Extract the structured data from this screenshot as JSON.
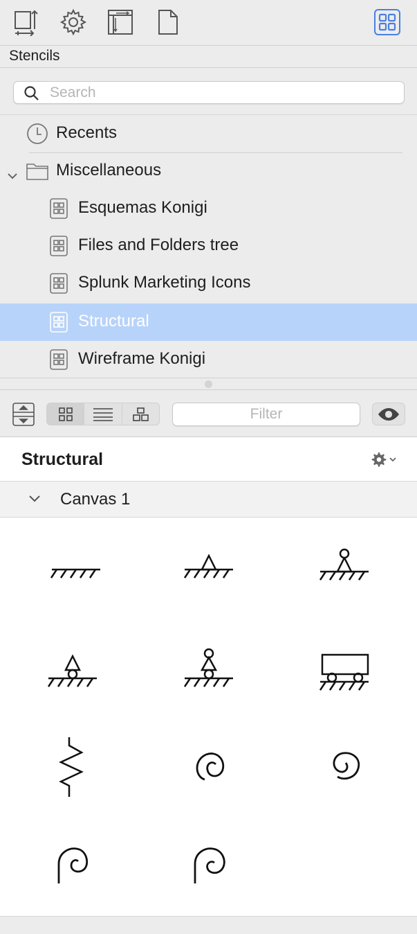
{
  "toolbar": {
    "buttons": [
      {
        "name": "canvas-inspector-icon"
      },
      {
        "name": "settings-gear-icon"
      },
      {
        "name": "layout-inspector-icon"
      },
      {
        "name": "document-icon"
      },
      {
        "name": "stencils-grid-icon",
        "active": true
      }
    ],
    "accent_color": "#4a7fe0"
  },
  "panel": {
    "title": "Stencils"
  },
  "search": {
    "placeholder": "Search",
    "value": ""
  },
  "tree": {
    "recents_label": "Recents",
    "folder_label": "Miscellaneous",
    "items": [
      {
        "label": "Esquemas Konigi"
      },
      {
        "label": "Files and Folders tree"
      },
      {
        "label": "Splunk Marketing Icons"
      },
      {
        "label": "Structural",
        "selected": true
      },
      {
        "label": "Wireframe Konigi"
      }
    ],
    "selected_color": "#b8d3f9"
  },
  "view": {
    "filter_placeholder": "Filter",
    "filter_value": "",
    "modes": [
      "grid-view-icon",
      "list-view-icon",
      "outline-view-icon"
    ]
  },
  "stencil": {
    "title": "Structural",
    "canvas_label": "Canvas 1",
    "shapes": [
      {
        "name": "fixed-ground-shape"
      },
      {
        "name": "pin-support-shape"
      },
      {
        "name": "hinged-pin-support-shape"
      },
      {
        "name": "roller-support-shape"
      },
      {
        "name": "hinged-roller-support-shape"
      },
      {
        "name": "cart-support-shape"
      },
      {
        "name": "spring-shape"
      },
      {
        "name": "torsion-spring-shape"
      },
      {
        "name": "torsion-spring-alt-shape"
      },
      {
        "name": "rotational-spring-shape"
      },
      {
        "name": "rotational-spring-alt-shape"
      }
    ]
  }
}
